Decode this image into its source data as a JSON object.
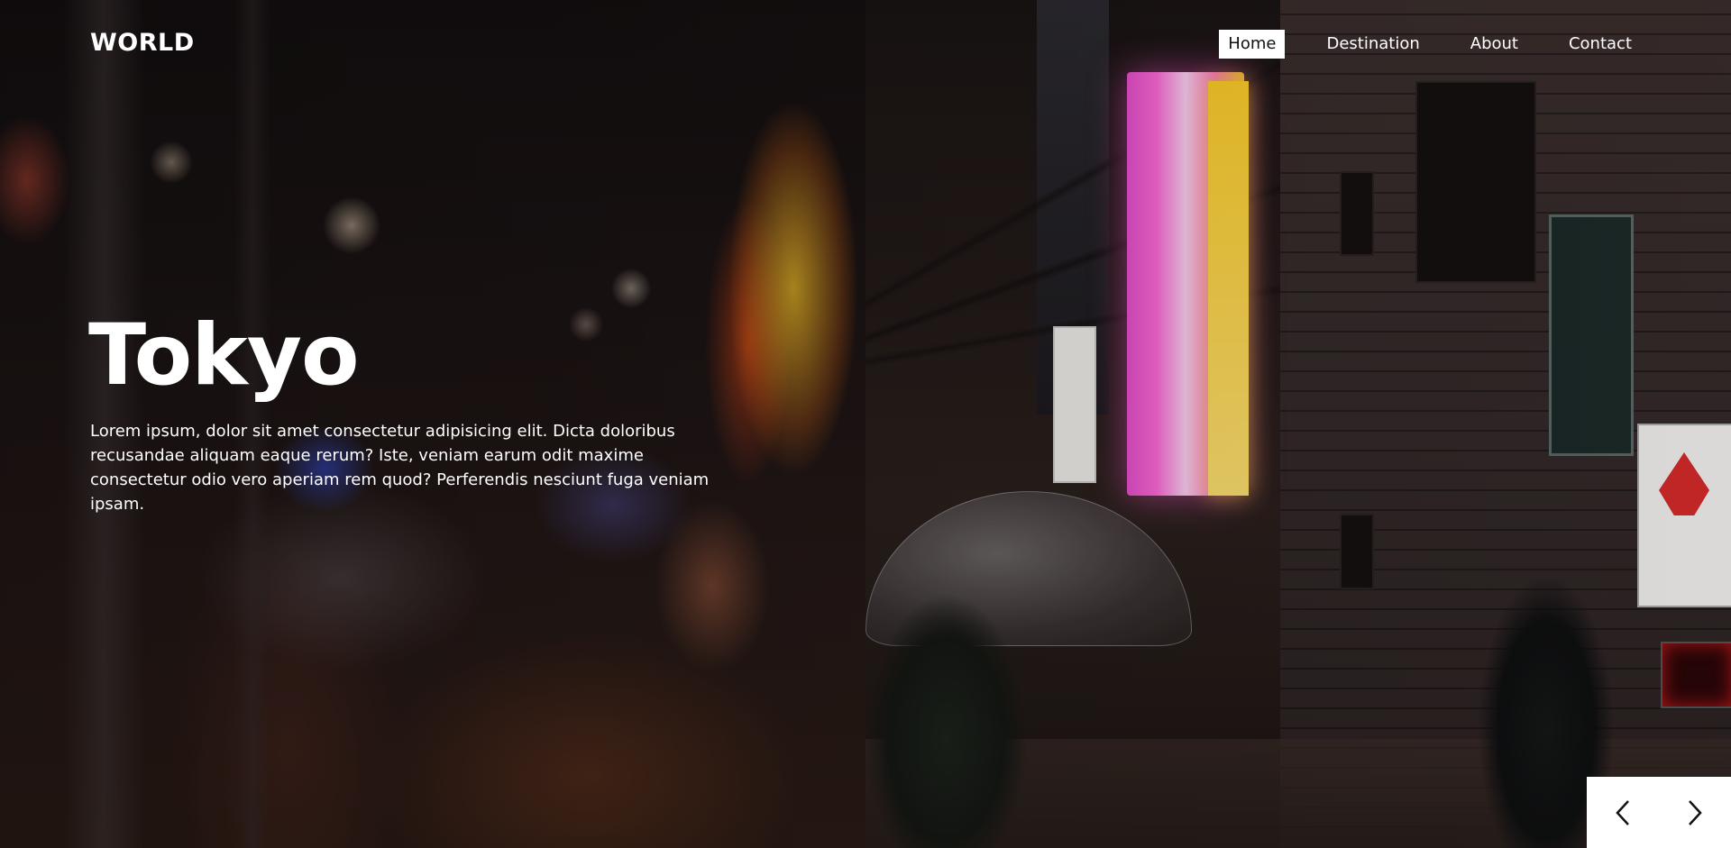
{
  "brand": {
    "logo_text": "WORLD"
  },
  "nav": {
    "items": [
      {
        "label": "Home",
        "active": true
      },
      {
        "label": "Destination",
        "active": false
      },
      {
        "label": "About",
        "active": false
      },
      {
        "label": "Contact",
        "active": false
      }
    ]
  },
  "hero": {
    "title": "Tokyo",
    "description": "Lorem ipsum, dolor sit amet consectetur adipisicing elit. Dicta doloribus recusandae aliquam eaque rerum? Iste, veniam earum odit maxime consectetur odio vero aperiam rem quod? Perferendis nesciunt fuga veniam ipsam.",
    "background_image": "night-street-tokyo-rain-umbrella"
  },
  "slider": {
    "prev_icon": "chevron-left-icon",
    "next_icon": "chevron-right-icon"
  },
  "colors": {
    "text": "#ffffff",
    "active_nav_bg": "#ffffff",
    "active_nav_text": "#111111",
    "controls_bg": "#ffffff"
  }
}
